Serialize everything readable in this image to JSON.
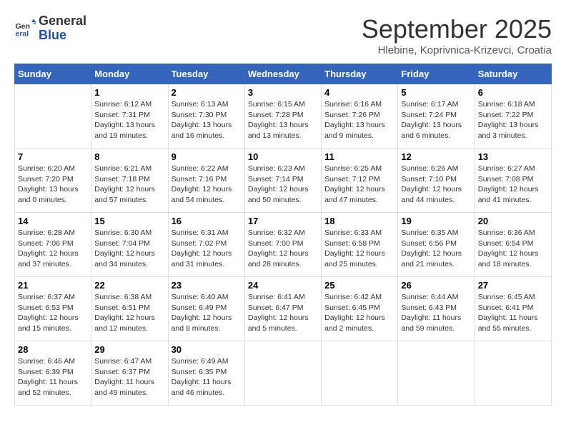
{
  "logo": {
    "general": "General",
    "blue": "Blue"
  },
  "title": "September 2025",
  "location": "Hlebine, Koprivnica-Krizevci, Croatia",
  "weekdays": [
    "Sunday",
    "Monday",
    "Tuesday",
    "Wednesday",
    "Thursday",
    "Friday",
    "Saturday"
  ],
  "weeks": [
    [
      {
        "day": "",
        "info": ""
      },
      {
        "day": "1",
        "info": "Sunrise: 6:12 AM\nSunset: 7:31 PM\nDaylight: 13 hours\nand 19 minutes."
      },
      {
        "day": "2",
        "info": "Sunrise: 6:13 AM\nSunset: 7:30 PM\nDaylight: 13 hours\nand 16 minutes."
      },
      {
        "day": "3",
        "info": "Sunrise: 6:15 AM\nSunset: 7:28 PM\nDaylight: 13 hours\nand 13 minutes."
      },
      {
        "day": "4",
        "info": "Sunrise: 6:16 AM\nSunset: 7:26 PM\nDaylight: 13 hours\nand 9 minutes."
      },
      {
        "day": "5",
        "info": "Sunrise: 6:17 AM\nSunset: 7:24 PM\nDaylight: 13 hours\nand 6 minutes."
      },
      {
        "day": "6",
        "info": "Sunrise: 6:18 AM\nSunset: 7:22 PM\nDaylight: 13 hours\nand 3 minutes."
      }
    ],
    [
      {
        "day": "7",
        "info": "Sunrise: 6:20 AM\nSunset: 7:20 PM\nDaylight: 13 hours\nand 0 minutes."
      },
      {
        "day": "8",
        "info": "Sunrise: 6:21 AM\nSunset: 7:18 PM\nDaylight: 12 hours\nand 57 minutes."
      },
      {
        "day": "9",
        "info": "Sunrise: 6:22 AM\nSunset: 7:16 PM\nDaylight: 12 hours\nand 54 minutes."
      },
      {
        "day": "10",
        "info": "Sunrise: 6:23 AM\nSunset: 7:14 PM\nDaylight: 12 hours\nand 50 minutes."
      },
      {
        "day": "11",
        "info": "Sunrise: 6:25 AM\nSunset: 7:12 PM\nDaylight: 12 hours\nand 47 minutes."
      },
      {
        "day": "12",
        "info": "Sunrise: 6:26 AM\nSunset: 7:10 PM\nDaylight: 12 hours\nand 44 minutes."
      },
      {
        "day": "13",
        "info": "Sunrise: 6:27 AM\nSunset: 7:08 PM\nDaylight: 12 hours\nand 41 minutes."
      }
    ],
    [
      {
        "day": "14",
        "info": "Sunrise: 6:28 AM\nSunset: 7:06 PM\nDaylight: 12 hours\nand 37 minutes."
      },
      {
        "day": "15",
        "info": "Sunrise: 6:30 AM\nSunset: 7:04 PM\nDaylight: 12 hours\nand 34 minutes."
      },
      {
        "day": "16",
        "info": "Sunrise: 6:31 AM\nSunset: 7:02 PM\nDaylight: 12 hours\nand 31 minutes."
      },
      {
        "day": "17",
        "info": "Sunrise: 6:32 AM\nSunset: 7:00 PM\nDaylight: 12 hours\nand 28 minutes."
      },
      {
        "day": "18",
        "info": "Sunrise: 6:33 AM\nSunset: 6:58 PM\nDaylight: 12 hours\nand 25 minutes."
      },
      {
        "day": "19",
        "info": "Sunrise: 6:35 AM\nSunset: 6:56 PM\nDaylight: 12 hours\nand 21 minutes."
      },
      {
        "day": "20",
        "info": "Sunrise: 6:36 AM\nSunset: 6:54 PM\nDaylight: 12 hours\nand 18 minutes."
      }
    ],
    [
      {
        "day": "21",
        "info": "Sunrise: 6:37 AM\nSunset: 6:53 PM\nDaylight: 12 hours\nand 15 minutes."
      },
      {
        "day": "22",
        "info": "Sunrise: 6:38 AM\nSunset: 6:51 PM\nDaylight: 12 hours\nand 12 minutes."
      },
      {
        "day": "23",
        "info": "Sunrise: 6:40 AM\nSunset: 6:49 PM\nDaylight: 12 hours\nand 8 minutes."
      },
      {
        "day": "24",
        "info": "Sunrise: 6:41 AM\nSunset: 6:47 PM\nDaylight: 12 hours\nand 5 minutes."
      },
      {
        "day": "25",
        "info": "Sunrise: 6:42 AM\nSunset: 6:45 PM\nDaylight: 12 hours\nand 2 minutes."
      },
      {
        "day": "26",
        "info": "Sunrise: 6:44 AM\nSunset: 6:43 PM\nDaylight: 11 hours\nand 59 minutes."
      },
      {
        "day": "27",
        "info": "Sunrise: 6:45 AM\nSunset: 6:41 PM\nDaylight: 11 hours\nand 55 minutes."
      }
    ],
    [
      {
        "day": "28",
        "info": "Sunrise: 6:46 AM\nSunset: 6:39 PM\nDaylight: 11 hours\nand 52 minutes."
      },
      {
        "day": "29",
        "info": "Sunrise: 6:47 AM\nSunset: 6:37 PM\nDaylight: 11 hours\nand 49 minutes."
      },
      {
        "day": "30",
        "info": "Sunrise: 6:49 AM\nSunset: 6:35 PM\nDaylight: 11 hours\nand 46 minutes."
      },
      {
        "day": "",
        "info": ""
      },
      {
        "day": "",
        "info": ""
      },
      {
        "day": "",
        "info": ""
      },
      {
        "day": "",
        "info": ""
      }
    ]
  ]
}
